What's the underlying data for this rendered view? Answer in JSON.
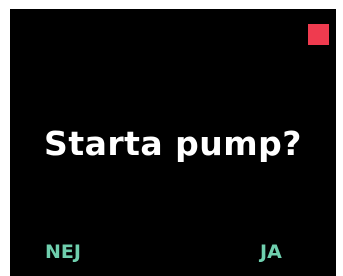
{
  "dialog": {
    "prompt": "Starta pump?",
    "no_label": "NEJ",
    "yes_label": "JA"
  },
  "colors": {
    "screen_background": "#000000",
    "prompt_text": "#ffffff",
    "softkey_text": "#6fcfae",
    "status_indicator": "#ef3b4f"
  }
}
